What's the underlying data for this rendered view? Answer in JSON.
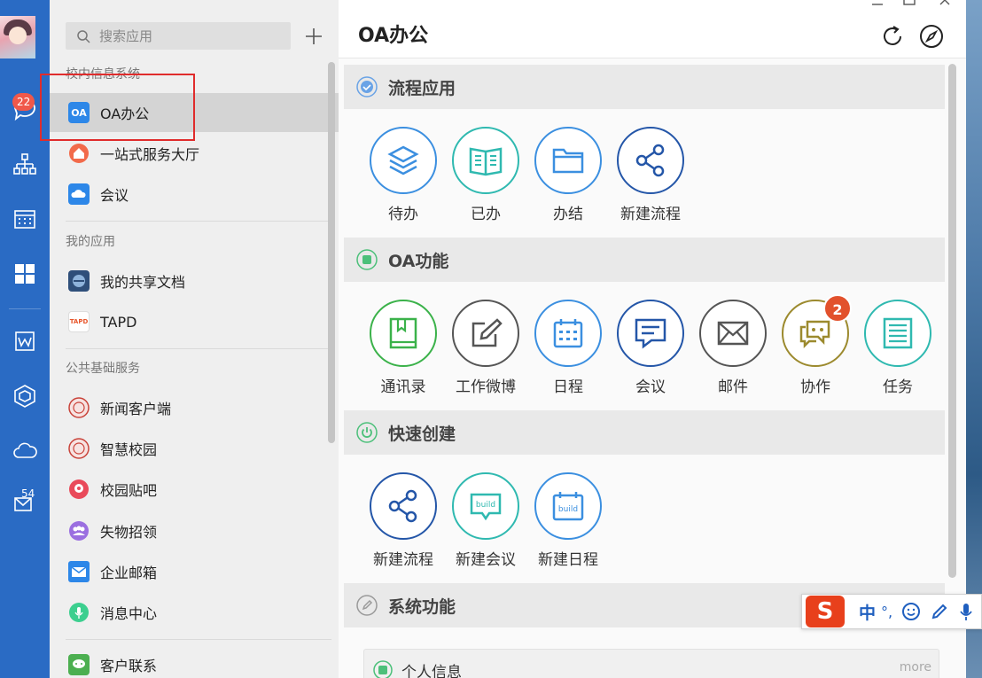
{
  "rail": {
    "chat_badge": "22",
    "mail_count": "54"
  },
  "panel": {
    "search_placeholder": "搜索应用",
    "sections": [
      {
        "title": "校内信息系统"
      },
      {
        "title": "我的应用"
      },
      {
        "title": "公共基础服务"
      }
    ],
    "apps": [
      {
        "label": "OA办公",
        "icon_text": "OA",
        "color": "#2d87e8"
      },
      {
        "label": "一站式服务大厅",
        "color": "#f26a4a"
      },
      {
        "label": "会议",
        "color": "#2d87e8"
      },
      {
        "label": "我的共享文档",
        "color": "#3b5f8f"
      },
      {
        "label": "TAPD",
        "icon_text": "TAPD",
        "color": "#f2a324"
      },
      {
        "label": "新闻客户端",
        "color": "#c9433a"
      },
      {
        "label": "智慧校园",
        "color": "#c9433a"
      },
      {
        "label": "校园贴吧",
        "color": "#e94a5a"
      },
      {
        "label": "失物招领",
        "color": "#9b6fe0"
      },
      {
        "label": "企业邮箱",
        "color": "#2d87e8"
      },
      {
        "label": "消息中心",
        "color": "#3ccf8f"
      },
      {
        "label": "客户联系",
        "color": "#4caf50"
      }
    ]
  },
  "main": {
    "title": "OA办公",
    "sections": [
      {
        "label": "流程应用",
        "color": "#6aa3e6"
      },
      {
        "label": "OA功能",
        "color": "#4cc07a"
      },
      {
        "label": "快速创建",
        "color": "#4cc07a"
      },
      {
        "label": "系统功能",
        "color": "#9a9a9a"
      }
    ],
    "flow": [
      {
        "label": "待办",
        "color": "#3b8fe0"
      },
      {
        "label": "已办",
        "color": "#2fb9b0"
      },
      {
        "label": "办结",
        "color": "#3b8fe0"
      },
      {
        "label": "新建流程",
        "color": "#2456a8"
      }
    ],
    "oa": [
      {
        "label": "通讯录",
        "color": "#3bb24a"
      },
      {
        "label": "工作微博",
        "color": "#555555"
      },
      {
        "label": "日程",
        "color": "#3b8fe0"
      },
      {
        "label": "会议",
        "color": "#2456a8"
      },
      {
        "label": "邮件",
        "color": "#555555"
      },
      {
        "label": "协作",
        "color": "#9c8a2e",
        "badge": "2"
      },
      {
        "label": "任务",
        "color": "#2fb9b0"
      }
    ],
    "quick": [
      {
        "label": "新建流程",
        "color": "#2456a8"
      },
      {
        "label": "新建会议",
        "color": "#2fb9b0",
        "icon_text": "build"
      },
      {
        "label": "新建日程",
        "color": "#3b8fe0",
        "icon_text": "build"
      }
    ],
    "info_card": {
      "label": "个人信息",
      "more": "more"
    }
  },
  "ime": {
    "logo": "S",
    "mode": "中",
    "punct": "°,"
  }
}
